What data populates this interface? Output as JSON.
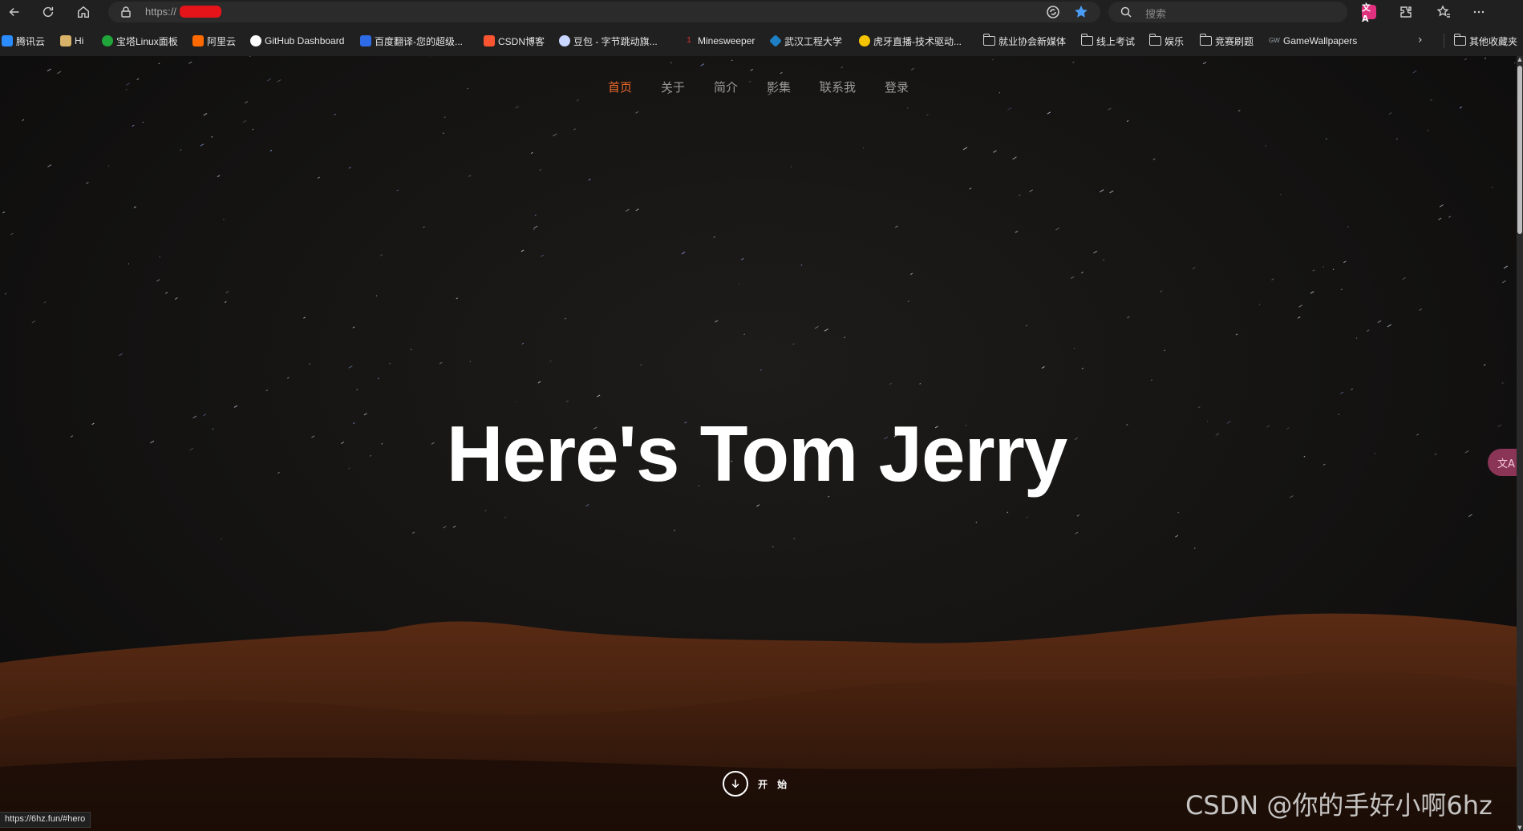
{
  "browser": {
    "url_prefix": "https://",
    "search_placeholder": "搜索",
    "translate_ext_label": "文A"
  },
  "bookmarks": [
    {
      "label": "腾讯云",
      "color": "#2a8cff"
    },
    {
      "label": "Hi",
      "color": "#d9b26a"
    },
    {
      "label": "宝塔Linux面板",
      "color": "#20a53a"
    },
    {
      "label": "阿里云",
      "color": "#ff6a00"
    },
    {
      "label": "GitHub Dashboard",
      "color": "#ffffff"
    },
    {
      "label": "百度翻译-您的超级...",
      "color": "#2e6be6"
    },
    {
      "label": "CSDN博客",
      "color": "#fc5531"
    },
    {
      "label": "豆包 - 字节跳动旗...",
      "color": "#c9d6ff"
    },
    {
      "label": "Minesweeper",
      "color": "#d93434"
    },
    {
      "label": "武汉工程大学",
      "color": "#1f7fc4"
    },
    {
      "label": "虎牙直播-技术驱动...",
      "color": "#f5c400"
    },
    {
      "label": "就业协会新媒体",
      "color": "folder"
    },
    {
      "label": "线上考试",
      "color": "folder"
    },
    {
      "label": "娱乐",
      "color": "folder"
    },
    {
      "label": "竞赛刷题",
      "color": "folder"
    },
    {
      "label": "GameWallpapers",
      "color": "#9aa0a6"
    }
  ],
  "bookmarks_other": "其他收藏夹",
  "nav": [
    {
      "label": "首页",
      "active": true
    },
    {
      "label": "关于",
      "active": false
    },
    {
      "label": "简介",
      "active": false
    },
    {
      "label": "影集",
      "active": false
    },
    {
      "label": "联系我",
      "active": false
    },
    {
      "label": "登录",
      "active": false
    }
  ],
  "hero": {
    "title": "Here's Tom Jerry",
    "start_label": "开 始"
  },
  "float_translate_label": "文A",
  "watermark": "CSDN @你的手好小啊6hz",
  "status_url": "https://6hz.fun/#hero",
  "colors": {
    "nav_active": "#ef6a2a",
    "nav_inactive": "#9a9a9a",
    "accent_star": "#4a9df6"
  }
}
